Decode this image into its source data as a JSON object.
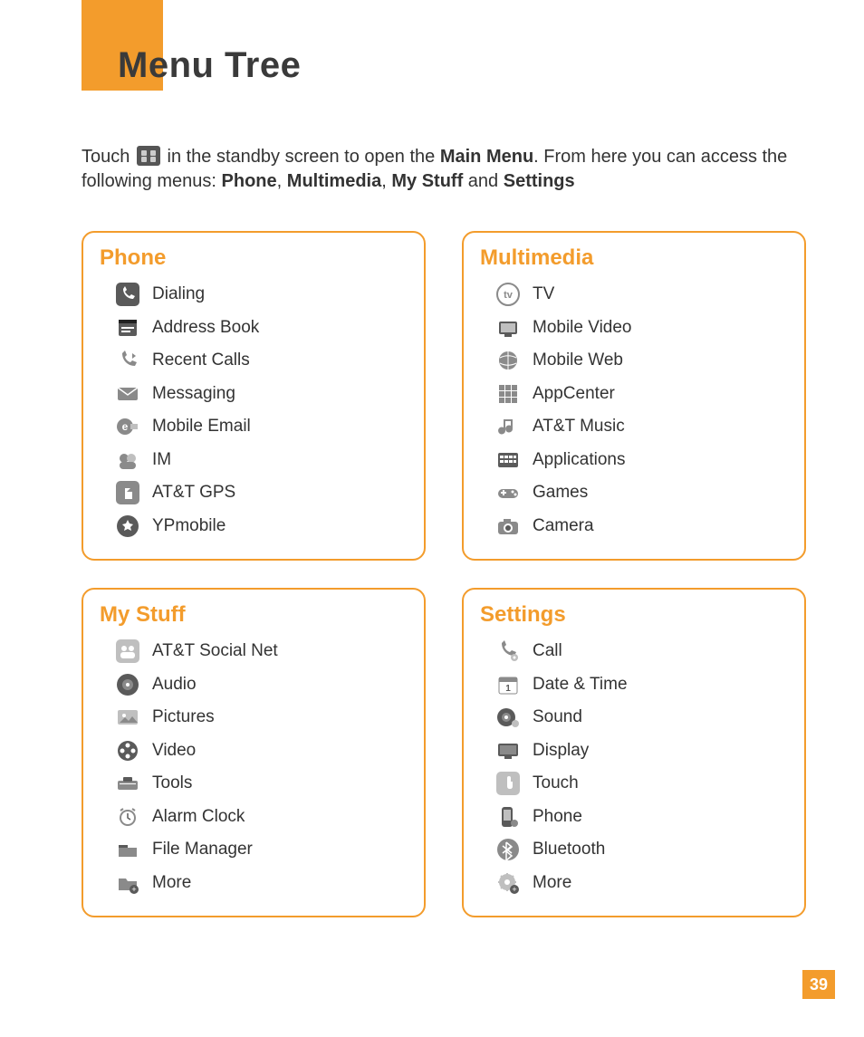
{
  "title": "Menu Tree",
  "intro": {
    "prefix": "Touch ",
    "mid": " in the standby screen to open the ",
    "bold1": "Main Menu",
    "after1": ". From here you can access the following menus: ",
    "b_phone": "Phone",
    "b_mm": "Multimedia",
    "b_my": "My Stuff",
    "and": " and ",
    "b_set": "Settings",
    "comma": ", "
  },
  "sections": {
    "phone": {
      "title": "Phone",
      "items": [
        {
          "label": "Dialing",
          "icon": "phone"
        },
        {
          "label": "Address Book",
          "icon": "book"
        },
        {
          "label": "Recent Calls",
          "icon": "recent"
        },
        {
          "label": "Messaging",
          "icon": "envelope"
        },
        {
          "label": "Mobile Email",
          "icon": "email"
        },
        {
          "label": "IM",
          "icon": "im"
        },
        {
          "label": "AT&T GPS",
          "icon": "gps"
        },
        {
          "label": "YPmobile",
          "icon": "yp"
        }
      ]
    },
    "multimedia": {
      "title": "Multimedia",
      "items": [
        {
          "label": "TV",
          "icon": "tv"
        },
        {
          "label": "Mobile Video",
          "icon": "video"
        },
        {
          "label": "Mobile Web",
          "icon": "web"
        },
        {
          "label": "AppCenter",
          "icon": "appcenter"
        },
        {
          "label": "AT&T Music",
          "icon": "music"
        },
        {
          "label": "Applications",
          "icon": "apps"
        },
        {
          "label": "Games",
          "icon": "games"
        },
        {
          "label": "Camera",
          "icon": "camera"
        }
      ]
    },
    "mystuff": {
      "title": "My Stuff",
      "items": [
        {
          "label": "AT&T Social Net",
          "icon": "social"
        },
        {
          "label": "Audio",
          "icon": "audio"
        },
        {
          "label": "Pictures",
          "icon": "pictures"
        },
        {
          "label": "Video",
          "icon": "reel"
        },
        {
          "label": "Tools",
          "icon": "tools"
        },
        {
          "label": "Alarm Clock",
          "icon": "alarm"
        },
        {
          "label": "File Manager",
          "icon": "folder"
        },
        {
          "label": "More",
          "icon": "more"
        }
      ]
    },
    "settings": {
      "title": "Settings",
      "items": [
        {
          "label": "Call",
          "icon": "callset"
        },
        {
          "label": "Date & Time",
          "icon": "calendar"
        },
        {
          "label": "Sound",
          "icon": "sound"
        },
        {
          "label": "Display",
          "icon": "display"
        },
        {
          "label": "Touch",
          "icon": "touch"
        },
        {
          "label": "Phone",
          "icon": "phoneset"
        },
        {
          "label": "Bluetooth",
          "icon": "bluetooth"
        },
        {
          "label": "More",
          "icon": "moreset"
        }
      ]
    }
  },
  "page_number": "39"
}
